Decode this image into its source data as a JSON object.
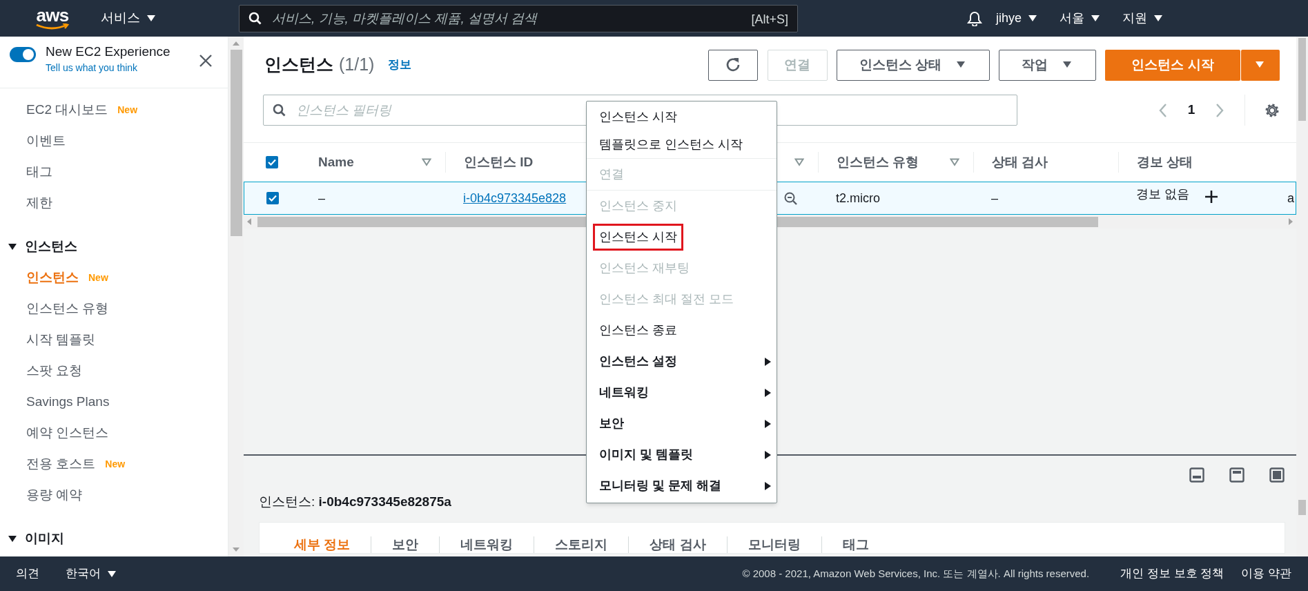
{
  "top_bar": {
    "logo": "aws",
    "services": "서비스",
    "search_placeholder": "서비스, 기능, 마켓플레이스 제품, 설명서 검색",
    "shortcut": "[Alt+S]",
    "user": "jihye",
    "region": "서울",
    "support": "지원"
  },
  "sidebar": {
    "toggle": {
      "label": "New EC2 Experience",
      "on": true
    },
    "feedback_link": "Tell us what you think",
    "items": [
      {
        "kind": "link",
        "label": "EC2 대시보드",
        "badge": "New",
        "selected": false
      },
      {
        "kind": "link",
        "label": "이벤트",
        "selected": false
      },
      {
        "kind": "link",
        "label": "태그",
        "selected": false
      },
      {
        "kind": "link",
        "label": "제한",
        "selected": false
      },
      {
        "kind": "section",
        "label": "인스턴스",
        "expanded": true
      },
      {
        "kind": "link",
        "label": "인스턴스",
        "badge": "New",
        "selected": true
      },
      {
        "kind": "link",
        "label": "인스턴스 유형",
        "selected": false
      },
      {
        "kind": "link",
        "label": "시작 템플릿",
        "selected": false
      },
      {
        "kind": "link",
        "label": "스팟 요청",
        "selected": false
      },
      {
        "kind": "link",
        "label": "Savings Plans",
        "selected": false
      },
      {
        "kind": "link",
        "label": "예약 인스턴스",
        "selected": false
      },
      {
        "kind": "link",
        "label": "전용 호스트",
        "badge": "New",
        "selected": false
      },
      {
        "kind": "link",
        "label": "용량 예약",
        "selected": false
      },
      {
        "kind": "section",
        "label": "이미지",
        "expanded": true
      }
    ]
  },
  "page": {
    "title": "인스턴스",
    "count": "(1/1)",
    "info": "정보",
    "buttons": [
      {
        "kind": "refresh"
      },
      {
        "kind": "plain",
        "label": "연결",
        "disabled": true
      },
      {
        "kind": "dropdown",
        "label": "인스턴스 상태",
        "disabled": false
      },
      {
        "kind": "dropdown",
        "label": "작업",
        "disabled": false
      },
      {
        "kind": "primary",
        "label": "인스턴스 시작",
        "disabled": false
      }
    ],
    "filter_placeholder": "인스턴스 필터링",
    "page_number": "1"
  },
  "table": {
    "all_checked": true,
    "columns": [
      {
        "label": "Name",
        "sortable": true
      },
      {
        "label": "인스턴스 ID",
        "sortable": false
      },
      {
        "sortable": true
      },
      {
        "label": "인스턴스 유형",
        "sortable": true
      },
      {
        "label": "상태 검사",
        "sortable": false
      },
      {
        "label": "경보 상태",
        "sortable": false
      }
    ],
    "rows": [
      {
        "selected": true,
        "cells": [
          "–",
          "i-0b4c973345e828",
          "",
          "t2.micro",
          "–",
          "경보 없음",
          "a"
        ]
      }
    ]
  },
  "context_menu": {
    "groups": [
      [
        {
          "kind": "action",
          "label": "인스턴스 시작",
          "disabled": false,
          "highlighted": false
        },
        {
          "kind": "action",
          "label": "템플릿으로 인스턴스 시작",
          "disabled": false,
          "highlighted": false
        }
      ],
      [
        {
          "kind": "action",
          "label": "연결",
          "disabled": true,
          "highlighted": false
        }
      ],
      [
        {
          "kind": "action",
          "label": "인스턴스 중지",
          "disabled": true,
          "highlighted": false
        },
        {
          "kind": "action",
          "label": "인스턴스 시작",
          "disabled": false,
          "highlighted": true
        },
        {
          "kind": "action",
          "label": "인스턴스 재부팅",
          "disabled": true,
          "highlighted": false
        },
        {
          "kind": "action",
          "label": "인스턴스 최대 절전 모드",
          "disabled": true,
          "highlighted": false
        },
        {
          "kind": "action",
          "label": "인스턴스 종료",
          "disabled": false,
          "highlighted": false
        },
        {
          "kind": "submenu",
          "label": "인스턴스 설정",
          "disabled": false,
          "highlighted": false
        },
        {
          "kind": "submenu",
          "label": "네트워킹",
          "disabled": false,
          "highlighted": false
        },
        {
          "kind": "submenu",
          "label": "보안",
          "disabled": false,
          "highlighted": false
        },
        {
          "kind": "submenu",
          "label": "이미지 및 템플릿",
          "disabled": false,
          "highlighted": false
        },
        {
          "kind": "submenu",
          "label": "모니터링 및 문제 해결",
          "disabled": false,
          "highlighted": false
        }
      ]
    ]
  },
  "details_panel": {
    "title": "인스턴스: **i-0b4c973345e82875a**",
    "tabs": [
      {
        "label": "세부 정보",
        "selected": true
      },
      {
        "label": "보안",
        "selected": false
      },
      {
        "label": "네트워킹",
        "selected": false
      },
      {
        "label": "스토리지",
        "selected": false
      },
      {
        "label": "상태 검사",
        "selected": false
      },
      {
        "label": "모니터링",
        "selected": false
      },
      {
        "label": "태그",
        "selected": false
      }
    ]
  },
  "footer": {
    "feedback": "의견",
    "language": "한국어",
    "copyright": "© 2008 - 2021, Amazon Web Services, Inc. 또는 계열사. All rights reserved.",
    "privacy": "개인 정보 보호 정책",
    "terms": "이용 약관"
  }
}
